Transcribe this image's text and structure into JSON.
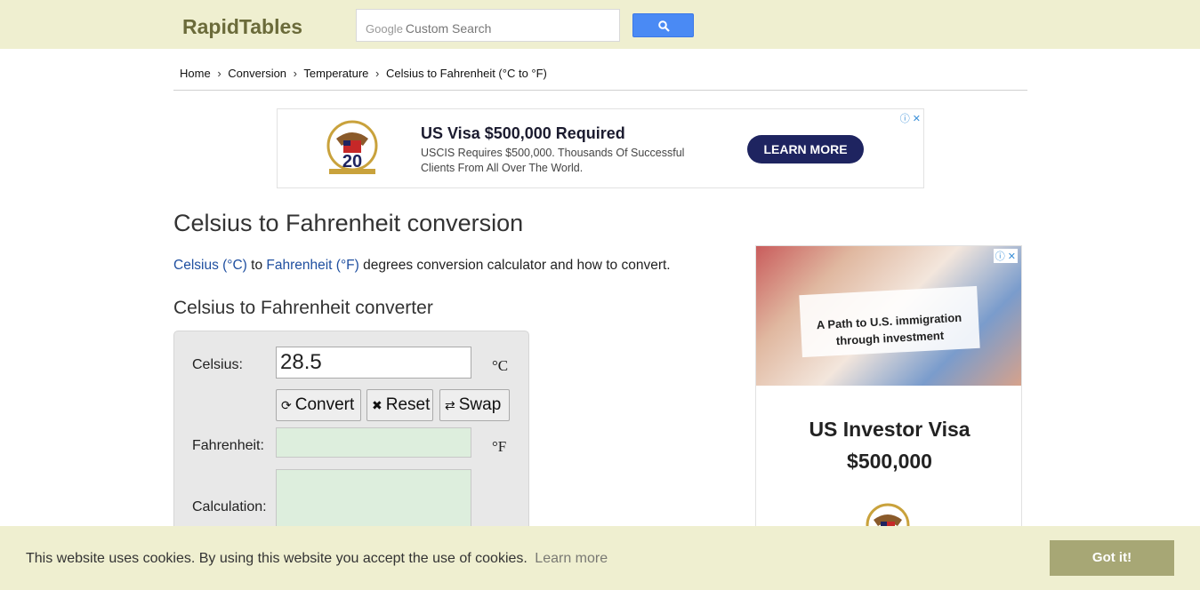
{
  "header": {
    "logo": "RapidTables",
    "search_google": "Google",
    "search_placeholder": "Custom Search"
  },
  "breadcrumb": [
    "Home",
    "Conversion",
    "Temperature",
    "Celsius to Fahrenheit (°C to °F)"
  ],
  "breadcrumb_sep": "›",
  "top_ad": {
    "headline": "US Visa $500,000 Required",
    "description": "USCIS Requires $500,000. Thousands Of Successful Clients From All Over The World.",
    "cta": "LEARN MORE",
    "badge": "ⓘ ✕"
  },
  "page": {
    "title": "Celsius to Fahrenheit conversion",
    "intro_link1": "Celsius (°C)",
    "intro_mid": " to ",
    "intro_link2": "Fahrenheit (°F)",
    "intro_rest": " degrees conversion calculator and how to convert.",
    "converter_heading": "Celsius to Fahrenheit converter"
  },
  "converter": {
    "celsius_label": "Celsius:",
    "celsius_value": "28.5",
    "celsius_unit": "°C",
    "convert_label": "Convert",
    "reset_label": "Reset",
    "swap_label": "Swap",
    "fahrenheit_label": "Fahrenheit:",
    "fahrenheit_unit": "°F",
    "calculation_label": "Calculation:"
  },
  "side_ad": {
    "banner_text": "A Path to U.S. immigration through investment",
    "headline_line1": "US Investor Visa",
    "headline_line2": "$500,000",
    "badge": "ⓘ ✕"
  },
  "cookie": {
    "message": "This website uses cookies. By using this website you accept the use of cookies.",
    "learn_more": "Learn more",
    "button": "Got it!"
  },
  "colors": {
    "topbar": "#efefd0",
    "logo": "#6b6b3a",
    "link": "#1f4fa0",
    "output_bg": "#ddeedd",
    "cookie_button": "#a7a775",
    "ad_button": "#1e2460"
  }
}
